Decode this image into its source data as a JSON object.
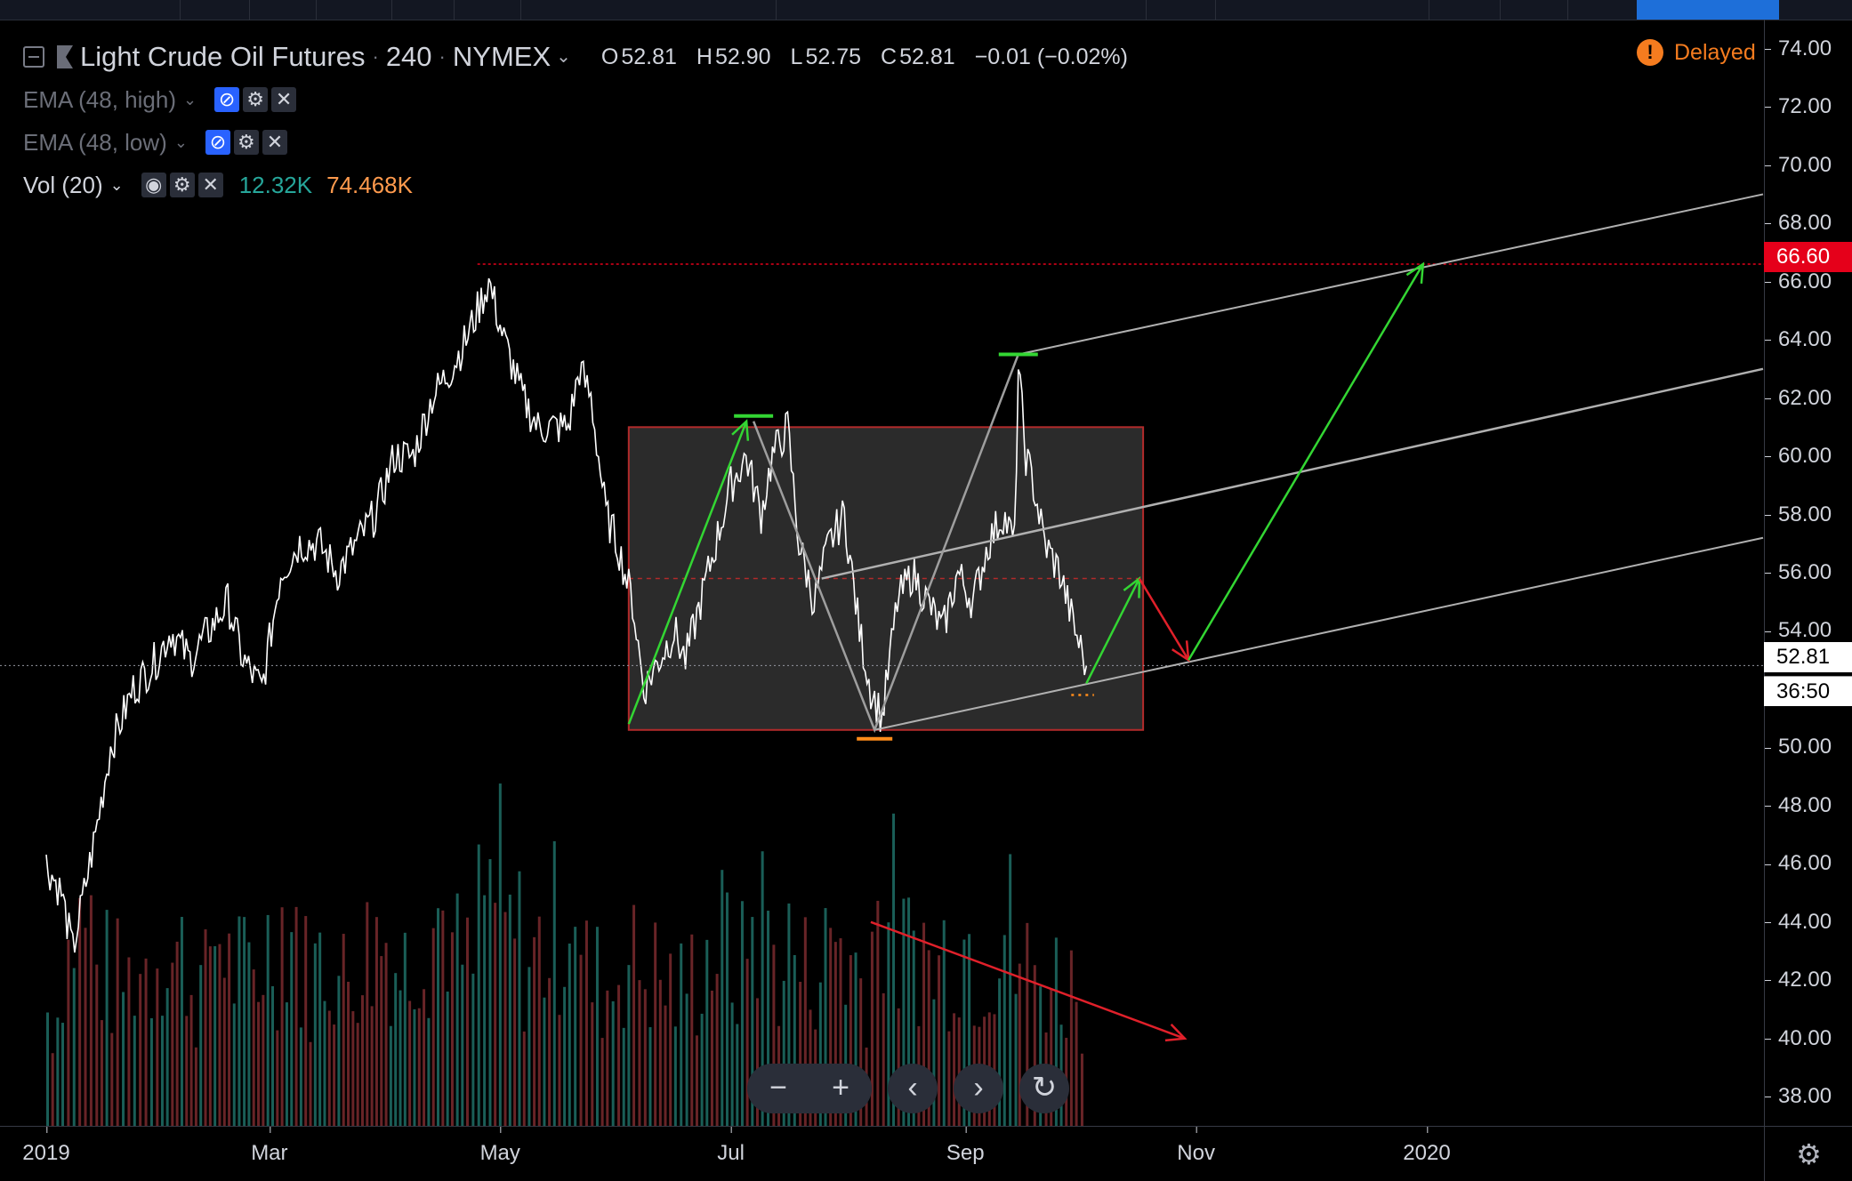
{
  "legend": {
    "symbol": "Light Crude Oil Futures",
    "interval": "240",
    "exchange": "NYMEX",
    "ohlc": {
      "o_label": "O",
      "o": "52.81",
      "h_label": "H",
      "h": "52.90",
      "l_label": "L",
      "l": "52.75",
      "c_label": "C",
      "c": "52.81",
      "change": "−0.01 (−0.02%)"
    },
    "indicators": [
      {
        "name": "EMA (48, high)"
      },
      {
        "name": "EMA (48, low)"
      },
      {
        "name": "Vol (20)",
        "value1": "12.32K",
        "value2": "74.468K"
      }
    ]
  },
  "status": {
    "delayed_label": "Delayed"
  },
  "price_axis": {
    "ticks": [
      "74.00",
      "72.00",
      "70.00",
      "68.00",
      "66.00",
      "64.00",
      "62.00",
      "60.00",
      "58.00",
      "56.00",
      "54.00",
      "50.00",
      "48.00",
      "46.00",
      "44.00",
      "42.00",
      "40.00",
      "38.00"
    ],
    "label_red": "66.60",
    "label_last": "52.81",
    "label_timer": "36:50"
  },
  "time_axis": {
    "ticks": [
      "2019",
      "Mar",
      "May",
      "Jul",
      "Sep",
      "Nov",
      "2020"
    ]
  },
  "chart_data": {
    "type": "line",
    "title": "Light Crude Oil Futures · 240 · NYMEX",
    "ylim": [
      37,
      75
    ],
    "x_ticks": [
      "2019",
      "Mar",
      "May",
      "Jul",
      "Sep",
      "Nov",
      "2020"
    ],
    "y_ticks": [
      74,
      72,
      70,
      68,
      66,
      64,
      62,
      60,
      58,
      56,
      54,
      52,
      50,
      48,
      46,
      44,
      42,
      40,
      38
    ],
    "series": [
      {
        "x": [
          "2019-01-01",
          "2019-01-05",
          "2019-01-08",
          "2019-01-14",
          "2019-01-18",
          "2019-01-24",
          "2019-01-30",
          "2019-02-03",
          "2019-02-08",
          "2019-02-13",
          "2019-02-18",
          "2019-02-22",
          "2019-02-27",
          "2019-03-04",
          "2019-03-09",
          "2019-03-14",
          "2019-03-19",
          "2019-03-24",
          "2019-03-29",
          "2019-04-03",
          "2019-04-08",
          "2019-04-13",
          "2019-04-18",
          "2019-04-22",
          "2019-04-25",
          "2019-04-28",
          "2019-05-02",
          "2019-05-07",
          "2019-05-11",
          "2019-05-15",
          "2019-05-19",
          "2019-05-22",
          "2019-05-25",
          "2019-05-29",
          "2019-06-01",
          "2019-06-05",
          "2019-06-08",
          "2019-06-12",
          "2019-06-16",
          "2019-06-19",
          "2019-06-23",
          "2019-06-27",
          "2019-07-01",
          "2019-07-05",
          "2019-07-09",
          "2019-07-12",
          "2019-07-16",
          "2019-07-19",
          "2019-07-23",
          "2019-07-27",
          "2019-07-31",
          "2019-08-04",
          "2019-08-07",
          "2019-08-10",
          "2019-08-14",
          "2019-08-18",
          "2019-08-22",
          "2019-08-26",
          "2019-08-30",
          "2019-09-03",
          "2019-09-07",
          "2019-09-11",
          "2019-09-14",
          "2019-09-15",
          "2019-09-17",
          "2019-09-19",
          "2019-09-22",
          "2019-09-26",
          "2019-09-30",
          "2019-10-03"
        ],
        "values": [
          46,
          45,
          43,
          47,
          50,
          52,
          53,
          54,
          53,
          54,
          55,
          53,
          52,
          56,
          57,
          57,
          56,
          57,
          58,
          60,
          60,
          62,
          63,
          64,
          65,
          66,
          64,
          62,
          61,
          61,
          61,
          63,
          62,
          58,
          57,
          55,
          52,
          53,
          54,
          53,
          55,
          57,
          59,
          60,
          58,
          60,
          61,
          57,
          55,
          57,
          58,
          54,
          52,
          51,
          55,
          56,
          55,
          54,
          56,
          55,
          57,
          58,
          57,
          63,
          60,
          59,
          57,
          56,
          54,
          52.8
        ]
      },
      {
        "name": "Volume",
        "values": [
          30,
          45,
          52,
          40,
          38,
          42,
          48,
          44,
          36,
          50,
          41,
          39,
          47,
          53,
          40,
          44,
          38,
          46,
          49,
          42,
          51,
          55,
          44,
          40,
          58,
          62,
          49,
          43,
          47,
          52,
          64,
          41,
          38,
          36,
          44,
          42,
          40,
          37,
          35,
          39,
          45,
          48,
          41,
          52,
          55,
          43,
          47,
          40,
          44,
          50,
          42,
          39,
          53,
          57,
          45,
          48,
          41,
          46,
          49,
          43,
          47,
          52,
          40,
          44,
          42,
          38,
          39,
          37,
          36,
          34
        ]
      }
    ],
    "annotations": {
      "resistance_line": 66.6,
      "range_box": {
        "top": 61,
        "bottom": 50.6,
        "mid": 55.8
      },
      "range_box_dates": [
        "2019-06-04",
        "2019-10-18"
      ],
      "pattern_swing_highs": [
        61.2,
        63.5
      ],
      "pattern_swing_low": 50.6,
      "projection_target": 66.6
    }
  }
}
